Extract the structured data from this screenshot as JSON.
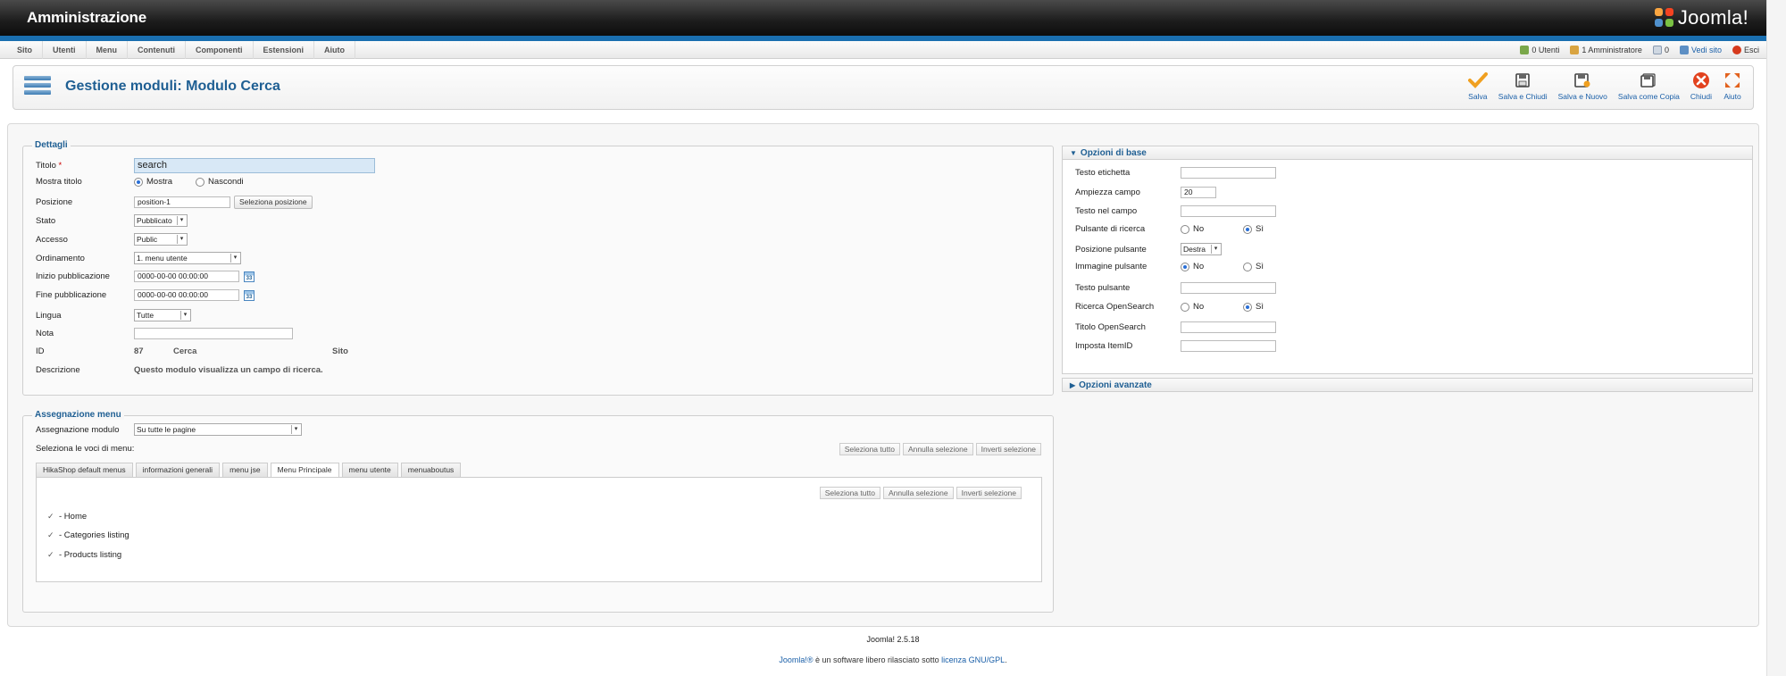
{
  "header": {
    "title": "Amministrazione",
    "logo_text": "Joomla!"
  },
  "menu": {
    "items": [
      "Sito",
      "Utenti",
      "Menu",
      "Contenuti",
      "Componenti",
      "Estensioni",
      "Aiuto"
    ]
  },
  "status": {
    "users": "0 Utenti",
    "admins": "1 Amministratore",
    "messages": "0",
    "view_site": "Vedi sito",
    "logout": "Esci"
  },
  "toolbar": {
    "page_title": "Gestione moduli: Modulo Cerca",
    "buttons": [
      "Salva",
      "Salva e Chiudi",
      "Salva e Nuovo",
      "Salva come Copia",
      "Chiudi",
      "Aiuto"
    ]
  },
  "details": {
    "legend": "Dettagli",
    "title_label": "Titolo",
    "required_mark": "*",
    "title_value": "search",
    "show_title_label": "Mostra titolo",
    "show_option": "Mostra",
    "hide_option": "Nascondi",
    "position_label": "Posizione",
    "position_value": "position-1",
    "position_button": "Seleziona posizione",
    "state_label": "Stato",
    "state_value": "Pubblicato",
    "access_label": "Accesso",
    "access_value": "Public",
    "ordering_label": "Ordinamento",
    "ordering_value": "1. menu utente",
    "publish_up_label": "Inizio pubblicazione",
    "publish_up_value": "0000-00-00 00:00:00",
    "publish_down_label": "Fine pubblicazione",
    "publish_down_value": "0000-00-00 00:00:00",
    "calendar_day": "33",
    "language_label": "Lingua",
    "language_value": "Tutte",
    "note_label": "Nota",
    "note_value": "",
    "id_label": "ID",
    "id_value": "87",
    "module_type": "Cerca",
    "client": "Sito",
    "description_label": "Descrizione",
    "description_value": "Questo modulo visualizza un campo di ricerca."
  },
  "assignment": {
    "legend": "Assegnazione menu",
    "module_assignment_label": "Assegnazione modulo",
    "module_assignment_value": "Su tutte le pagine",
    "select_items_label": "Seleziona le voci di menu:",
    "select_all": "Seleziona tutto",
    "clear_selection": "Annulla selezione",
    "toggle_selection": "Inverti selezione",
    "tabs": [
      "HikaShop default menus",
      "informazioni generali",
      "menu jse",
      "Menu Principale",
      "menu utente",
      "menuaboutus"
    ],
    "active_tab": "Menu Principale",
    "items": [
      "- Home",
      "- Categories listing",
      "- Products listing"
    ]
  },
  "basic_options": {
    "title": "Opzioni di base",
    "label_text_label": "Testo etichetta",
    "label_text_value": "",
    "width_label": "Ampiezza campo",
    "width_value": "20",
    "field_text_label": "Testo nel campo",
    "field_text_value": "",
    "search_button_label": "Pulsante di ricerca",
    "button_pos_label": "Posizione pulsante",
    "button_pos_value": "Destra",
    "image_button_label": "Immagine pulsante",
    "button_text_label": "Testo pulsante",
    "button_text_value": "",
    "opensearch_label": "Ricerca OpenSearch",
    "opensearch_title_label": "Titolo OpenSearch",
    "opensearch_title_value": "",
    "itemid_label": "Imposta ItemID",
    "itemid_value": "",
    "no": "No",
    "yes": "Sì"
  },
  "advanced_options": {
    "title": "Opzioni avanzate"
  },
  "footer": {
    "version": "Joomla! 2.5.18",
    "license_prefix": "Joomla!®",
    "license_mid": " è un software libero rilasciato sotto ",
    "license_link": "licenza GNU/GPL",
    "license_end": "."
  }
}
